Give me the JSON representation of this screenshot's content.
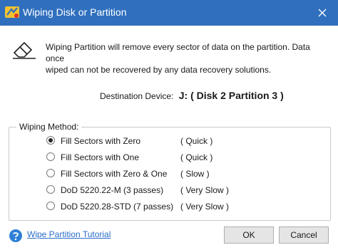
{
  "window": {
    "title": "Wiping Disk or Partition",
    "accent_color": "#2f6fbe"
  },
  "warning": {
    "icon": "eraser-icon",
    "text_line1": "Wiping Partition will remove every sector of data on the partition. Data once",
    "text_line2": "wiped can not be recovered by any data recovery solutions."
  },
  "destination": {
    "label": "Destination Device:",
    "value": "J: ( Disk 2 Partition 3 )"
  },
  "wiping_method": {
    "legend": "Wiping Method:",
    "options": [
      {
        "label": "Fill Sectors with Zero",
        "speed": "( Quick )",
        "selected": true
      },
      {
        "label": "Fill Sectors with One",
        "speed": "( Quick )",
        "selected": false
      },
      {
        "label": "Fill Sectors with Zero & One",
        "speed": "( Slow )",
        "selected": false
      },
      {
        "label": "DoD 5220.22-M (3 passes)",
        "speed": "( Very Slow )",
        "selected": false
      },
      {
        "label": "DoD 5220.28-STD (7 passes)",
        "speed": "( Very Slow )",
        "selected": false
      }
    ]
  },
  "footer": {
    "help_icon": "question-icon",
    "help_link": "Wipe Partition Tutorial",
    "ok_label": "OK",
    "cancel_label": "Cancel"
  }
}
